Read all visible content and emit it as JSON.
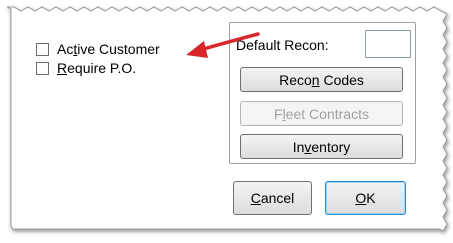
{
  "checkboxes": [
    {
      "pre": "Ac",
      "key": "t",
      "post": "ive Customer",
      "checked": false
    },
    {
      "pre": "",
      "key": "R",
      "post": "equire P.O.",
      "checked": false
    }
  ],
  "default_recon": {
    "label": "Default Recon:",
    "value": ""
  },
  "buttons": {
    "recon_codes": {
      "pre": "Reco",
      "key": "n",
      "post": " Codes",
      "enabled": true
    },
    "fleet_contracts": {
      "pre": "F",
      "key": "l",
      "post": "eet Contracts",
      "enabled": false
    },
    "inventory": {
      "pre": "In",
      "key": "v",
      "post": "entory",
      "enabled": true
    },
    "cancel": {
      "pre": "",
      "key": "C",
      "post": "ancel"
    },
    "ok": {
      "pre": "",
      "key": "O",
      "post": "K"
    }
  },
  "annotation": {
    "arrow_color": "#d8262b",
    "points_to": "active-customer-checkbox"
  },
  "colors": {
    "frame_border": "#9a9a9a",
    "default_button_border": "#2a8ad4"
  }
}
